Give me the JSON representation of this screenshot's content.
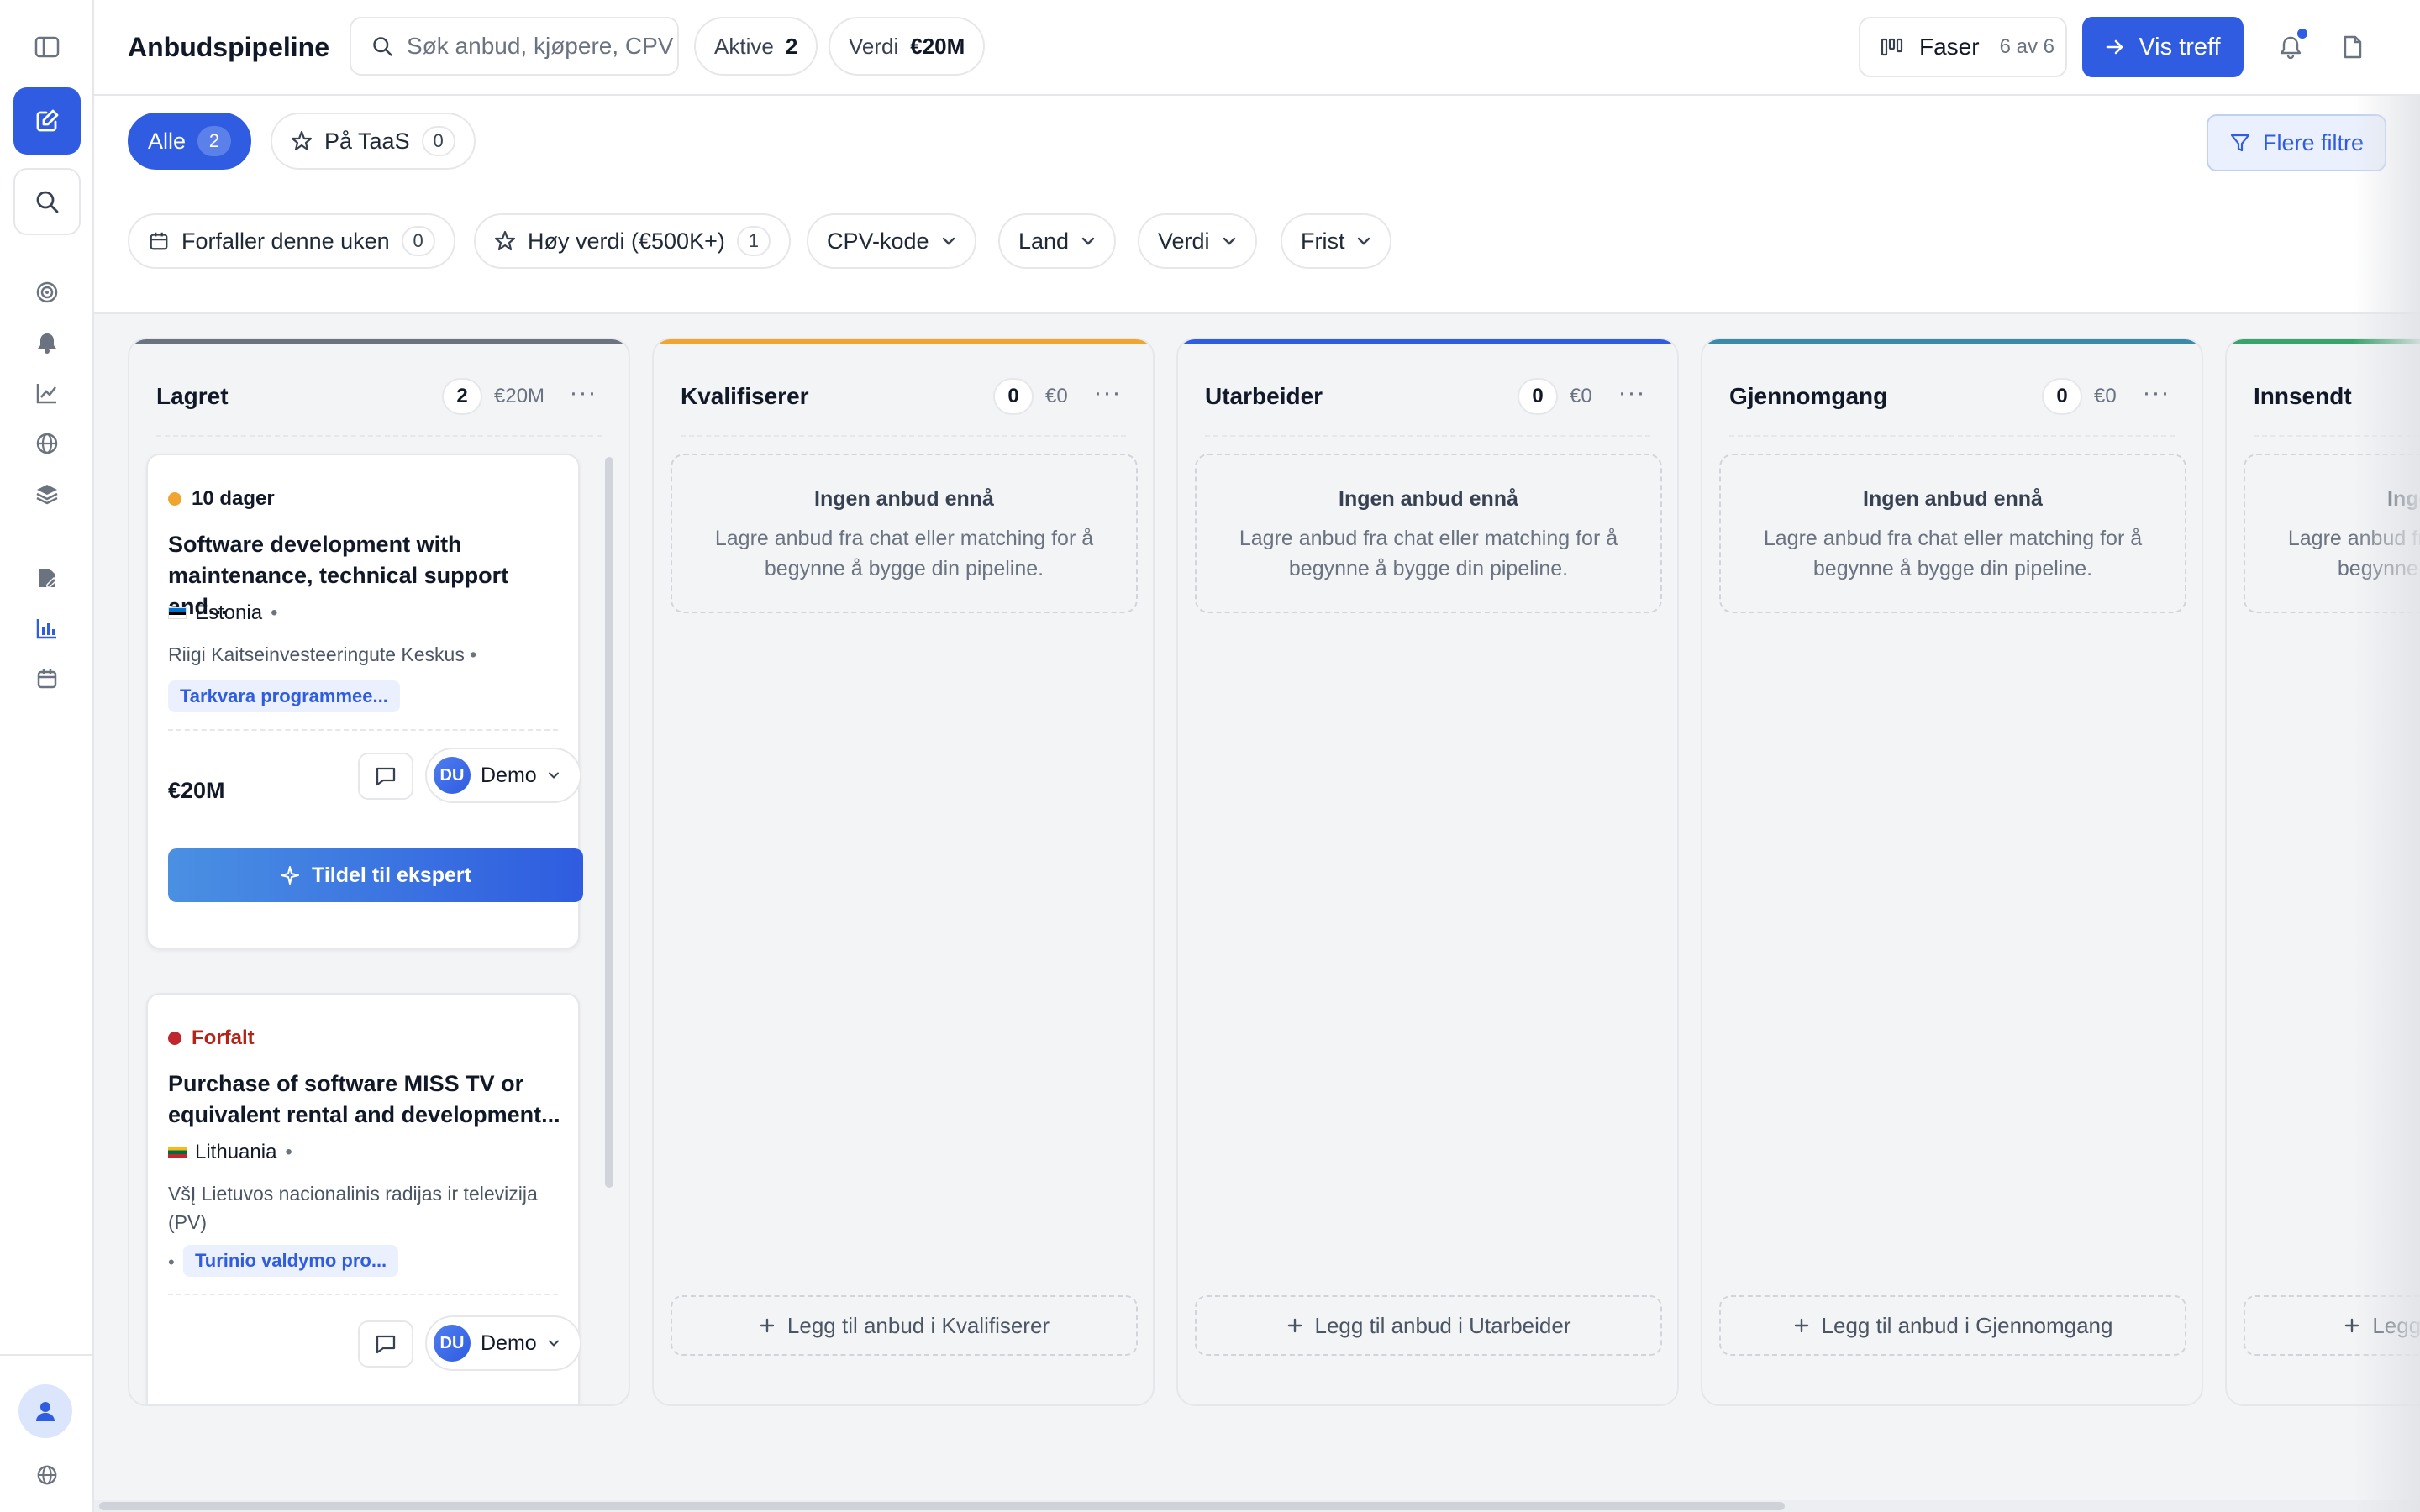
{
  "header": {
    "title": "Anbudspipeline",
    "search_placeholder": "Søk anbud, kjøpere, CPV",
    "active_label": "Aktive",
    "active_count": "2",
    "value_label": "Verdi",
    "value_total": "€20M",
    "phases_label": "Faser",
    "phases_count": "6 av 6",
    "vis_treff_label": "Vis treff"
  },
  "filters": {
    "all_label": "Alle",
    "all_count": "2",
    "taas_label": "På TaaS",
    "taas_count": "0",
    "more_filters_label": "Flere filtre",
    "due_week_label": "Forfaller denne uken",
    "due_week_count": "0",
    "high_value_label": "Høy verdi (€500K+)",
    "high_value_count": "1",
    "cpv_label": "CPV-kode",
    "country_label": "Land",
    "value_label": "Verdi",
    "deadline_label": "Frist"
  },
  "empty_state": {
    "title": "Ingen anbud ennå",
    "text": "Lagre anbud fra chat eller matching for å begynne å bygge din pipeline."
  },
  "columns": [
    {
      "name": "Lagret",
      "count": "2",
      "value": "€20M",
      "color": "#6b7280"
    },
    {
      "name": "Kvalifiserer",
      "count": "0",
      "value": "€0",
      "color": "#f0a530",
      "add_label": "Legg til anbud i Kvalifiserer"
    },
    {
      "name": "Utarbeider",
      "count": "0",
      "value": "€0",
      "color": "#2f5ce0",
      "add_label": "Legg til anbud i Utarbeider"
    },
    {
      "name": "Gjennomgang",
      "count": "0",
      "value": "€0",
      "color": "#3a8aa8",
      "add_label": "Legg til anbud i Gjennomgang"
    },
    {
      "name": "Innsendt",
      "color": "#3aa36b",
      "add_label": "Legg til anbud i Innsendt"
    }
  ],
  "cards": [
    {
      "deadline": "10 dager",
      "deadline_color": "#f0a530",
      "title": "Software development with maintenance, technical support and...",
      "country": "Estonia",
      "buyer": "Riigi Kaitseinvesteeringute Keskus",
      "tag": "Tarkvara programmee...",
      "value": "€20M",
      "user_initials": "DU",
      "user_name": "Demo",
      "assign_label": "Tildel til ekspert"
    },
    {
      "deadline": "Forfalt",
      "deadline_color": "#c0262d",
      "title": "Purchase of software MISS TV or equivalent rental and development...",
      "country": "Lithuania",
      "buyer": "VšĮ Lietuvos nacionalinis radijas ir televizija (PV)",
      "tag": "Turinio valdymo pro...",
      "user_initials": "DU",
      "user_name": "Demo"
    }
  ]
}
